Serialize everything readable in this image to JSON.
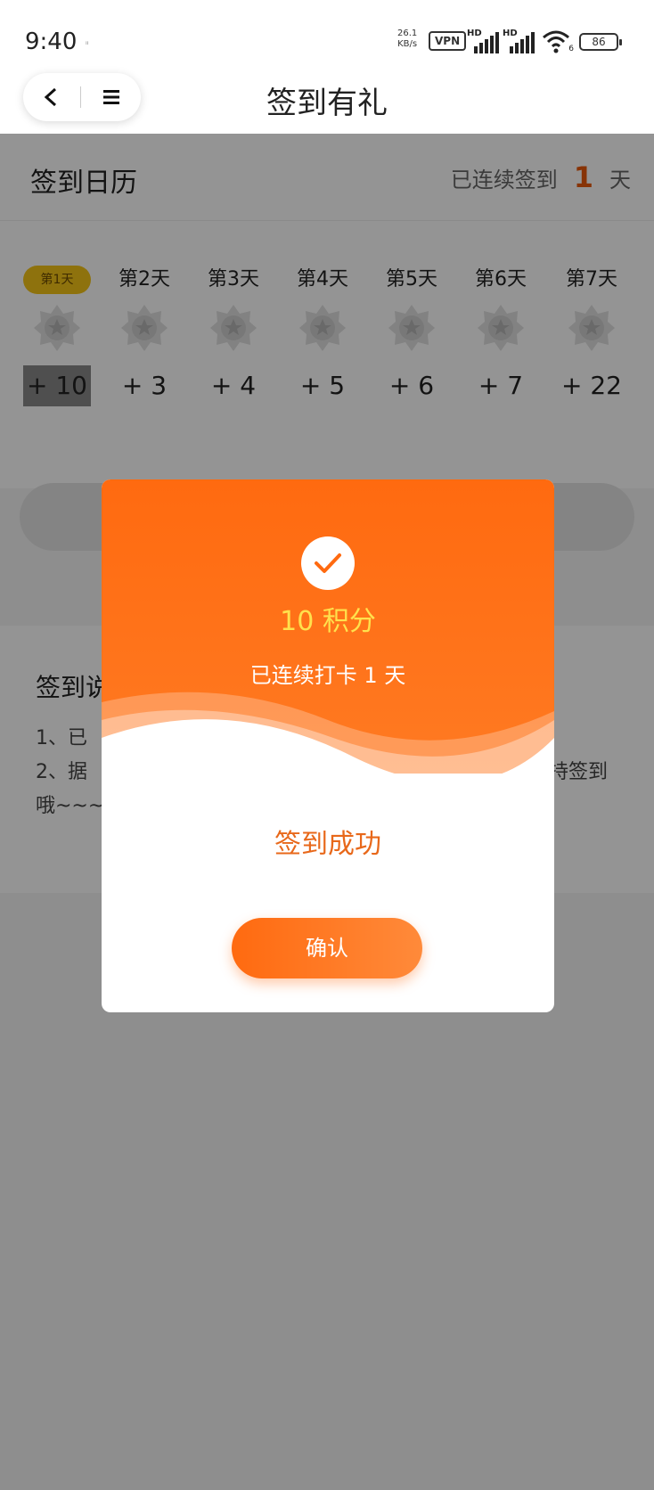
{
  "status_bar": {
    "time": "9:40",
    "extra": "ᵢᵢ",
    "net_speed": "26.1",
    "net_unit": "KB/s",
    "vpn": "VPN",
    "hd1": "HD",
    "hd2": "HD",
    "wifi_label": "6",
    "battery": "86"
  },
  "nav": {
    "title": "签到有礼"
  },
  "calendar": {
    "title": "签到日历",
    "streak_prefix": "已连续签到",
    "streak_count": "1",
    "streak_unit": "天",
    "days": [
      {
        "label": "第1天",
        "points": "+ 10"
      },
      {
        "label": "第2天",
        "points": "+ 3"
      },
      {
        "label": "第3天",
        "points": "+ 4"
      },
      {
        "label": "第4天",
        "points": "+ 5"
      },
      {
        "label": "第5天",
        "points": "+ 6"
      },
      {
        "label": "第6天",
        "points": "+ 7"
      },
      {
        "label": "第7天",
        "points": "+ 22"
      }
    ]
  },
  "rules": {
    "title": "签到说",
    "line1": "1、已",
    "line2": "2、据",
    "line2_end": "持签到",
    "line3": "哦~~~"
  },
  "modal": {
    "points_text": "10 积分",
    "streak_text": "已连续打卡 1 天",
    "success_text": "签到成功",
    "confirm_label": "确认"
  },
  "colors": {
    "accent": "#ff6a10",
    "points_yellow": "#ffe14d",
    "current_day": "#f5c518"
  }
}
